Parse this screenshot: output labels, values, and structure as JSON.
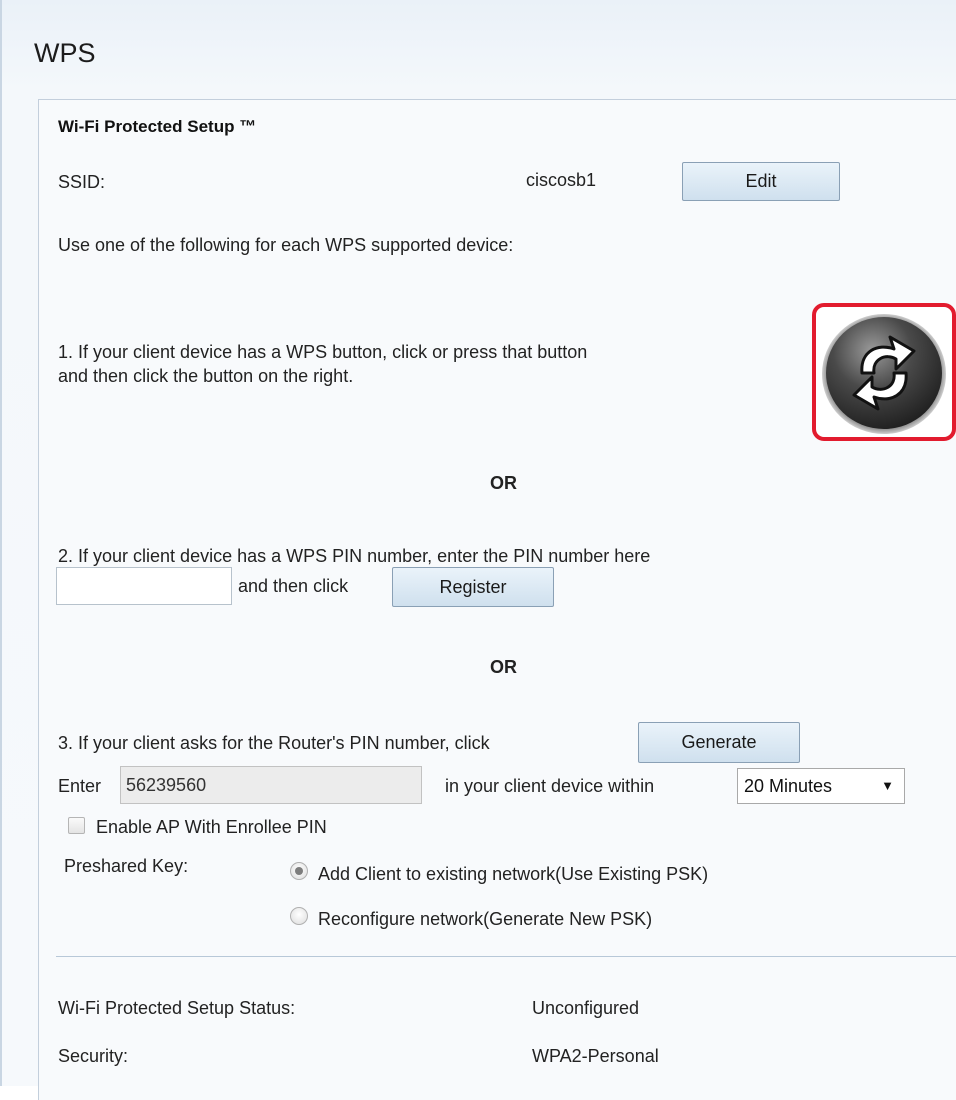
{
  "page": {
    "title": "WPS"
  },
  "section": {
    "title": "Wi-Fi Protected Setup ™"
  },
  "ssid": {
    "label": "SSID:",
    "value": "ciscosb1",
    "edit_label": "Edit"
  },
  "intro": "Use one of the following for each WPS supported device:",
  "option1": {
    "line1": "1. If your client device has a WPS button, click or press that button",
    "line2": "and then click the button on the right.",
    "wps_button_icon": "wps-sync-icon",
    "highlight_color": "#e21b2e"
  },
  "or_label": "OR",
  "option2": {
    "text": "2. If your client device has a WPS PIN number, enter the PIN number here",
    "pin_value": "",
    "after_input": "and then click",
    "register_label": "Register"
  },
  "option3": {
    "text": "3. If your client asks for the Router's PIN number, click",
    "generate_label": "Generate",
    "enter_label": "Enter",
    "pin_value": "56239560",
    "within_label": "in your client device within",
    "duration_selected": "20 Minutes"
  },
  "enrollee": {
    "label": "Enable AP With Enrollee PIN",
    "checked": false
  },
  "preshared": {
    "label": "Preshared Key:",
    "options": [
      {
        "label": "Add Client to existing network(Use Existing PSK)",
        "checked": true
      },
      {
        "label": "Reconfigure network(Generate New PSK)",
        "checked": false
      }
    ]
  },
  "status": {
    "label": "Wi-Fi Protected Setup Status:",
    "value": "Unconfigured",
    "security_label": "Security:",
    "security_value": "WPA2-Personal"
  }
}
